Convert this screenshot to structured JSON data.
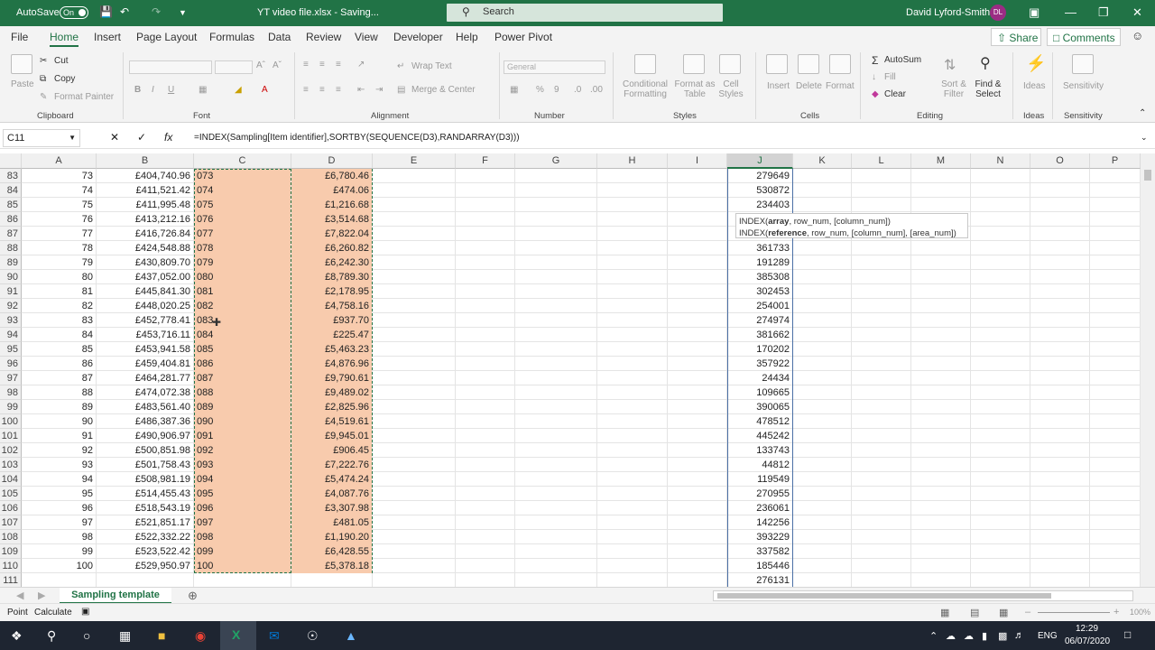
{
  "titlebar": {
    "autosave_label": "AutoSave",
    "autosave_state": "On",
    "document_title": "YT video file.xlsx  -  Saving...",
    "search_placeholder": "Search",
    "user_name": "David Lyford-Smith",
    "user_initials": "DL",
    "icons": [
      "save-icon",
      "undo-icon",
      "redo-icon",
      "customize-quick-access-icon",
      "ribbon-display-icon",
      "minimize-icon",
      "maximize-icon",
      "close-icon"
    ]
  },
  "menu": {
    "tabs": [
      "File",
      "Home",
      "Insert",
      "Page Layout",
      "Formulas",
      "Data",
      "Review",
      "View",
      "Developer",
      "Help",
      "Power Pivot"
    ],
    "active_tab": "Home",
    "share_label": "Share",
    "comments_label": "Comments"
  },
  "ribbon": {
    "clipboard": {
      "label": "Clipboard",
      "paste": "Paste",
      "cut": "Cut",
      "copy": "Copy",
      "format_painter": "Format Painter"
    },
    "font": {
      "label": "Font",
      "bold": "B",
      "italic": "I",
      "underline": "U"
    },
    "alignment": {
      "label": "Alignment",
      "wrap_text": "Wrap Text",
      "merge_center": "Merge & Center"
    },
    "number": {
      "label": "Number",
      "format": "General"
    },
    "styles": {
      "label": "Styles",
      "conditional_formatting": "Conditional Formatting",
      "format_as_table": "Format as Table",
      "cell_styles": "Cell Styles"
    },
    "cells": {
      "label": "Cells",
      "insert": "Insert",
      "delete": "Delete",
      "format": "Format"
    },
    "editing": {
      "label": "Editing",
      "autosum": "AutoSum",
      "fill": "Fill",
      "clear": "Clear",
      "sort_filter": "Sort & Filter",
      "find_select": "Find & Select"
    },
    "ideas": {
      "label": "Ideas",
      "ideas": "Ideas"
    },
    "sensitivity": {
      "label": "Sensitivity",
      "sensitivity": "Sensitivity"
    }
  },
  "formula_bar": {
    "name_box": "C11",
    "fx": "fx",
    "formula": "=INDEX(Sampling[Item identifier],SORTBY(SEQUENCE(D3),RANDARRAY(D3)))"
  },
  "grid": {
    "columns": [
      "A",
      "B",
      "C",
      "D",
      "E",
      "F",
      "G",
      "H",
      "I",
      "J",
      "K",
      "L",
      "M",
      "N",
      "O",
      "P"
    ],
    "selected_column": "J",
    "rows": [
      {
        "n": "83",
        "a": "73",
        "b": "£404,740.96",
        "c": "073",
        "d": "£6,780.46",
        "j": "279649"
      },
      {
        "n": "84",
        "a": "74",
        "b": "£411,521.42",
        "c": "074",
        "d": "£474.06",
        "j": "530872"
      },
      {
        "n": "85",
        "a": "75",
        "b": "£411,995.48",
        "c": "075",
        "d": "£1,216.68",
        "j": "234403"
      },
      {
        "n": "86",
        "a": "76",
        "b": "£413,212.16",
        "c": "076",
        "d": "£3,514.68",
        "j": ""
      },
      {
        "n": "87",
        "a": "77",
        "b": "£416,726.84",
        "c": "077",
        "d": "£7,822.04",
        "j": ""
      },
      {
        "n": "88",
        "a": "78",
        "b": "£424,548.88",
        "c": "078",
        "d": "£6,260.82",
        "j": "361733"
      },
      {
        "n": "89",
        "a": "79",
        "b": "£430,809.70",
        "c": "079",
        "d": "£6,242.30",
        "j": "191289"
      },
      {
        "n": "90",
        "a": "80",
        "b": "£437,052.00",
        "c": "080",
        "d": "£8,789.30",
        "j": "385308"
      },
      {
        "n": "91",
        "a": "81",
        "b": "£445,841.30",
        "c": "081",
        "d": "£2,178.95",
        "j": "302453"
      },
      {
        "n": "92",
        "a": "82",
        "b": "£448,020.25",
        "c": "082",
        "d": "£4,758.16",
        "j": "254001"
      },
      {
        "n": "93",
        "a": "83",
        "b": "£452,778.41",
        "c": "083",
        "d": "£937.70",
        "j": "274974"
      },
      {
        "n": "94",
        "a": "84",
        "b": "£453,716.11",
        "c": "084",
        "d": "£225.47",
        "j": "381662"
      },
      {
        "n": "95",
        "a": "85",
        "b": "£453,941.58",
        "c": "085",
        "d": "£5,463.23",
        "j": "170202"
      },
      {
        "n": "96",
        "a": "86",
        "b": "£459,404.81",
        "c": "086",
        "d": "£4,876.96",
        "j": "357922"
      },
      {
        "n": "97",
        "a": "87",
        "b": "£464,281.77",
        "c": "087",
        "d": "£9,790.61",
        "j": "24434"
      },
      {
        "n": "98",
        "a": "88",
        "b": "£474,072.38",
        "c": "088",
        "d": "£9,489.02",
        "j": "109665"
      },
      {
        "n": "99",
        "a": "89",
        "b": "£483,561.40",
        "c": "089",
        "d": "£2,825.96",
        "j": "390065"
      },
      {
        "n": "100",
        "a": "90",
        "b": "£486,387.36",
        "c": "090",
        "d": "£4,519.61",
        "j": "478512"
      },
      {
        "n": "101",
        "a": "91",
        "b": "£490,906.97",
        "c": "091",
        "d": "£9,945.01",
        "j": "445242"
      },
      {
        "n": "102",
        "a": "92",
        "b": "£500,851.98",
        "c": "092",
        "d": "£906.45",
        "j": "133743"
      },
      {
        "n": "103",
        "a": "93",
        "b": "£501,758.43",
        "c": "093",
        "d": "£7,222.76",
        "j": "44812"
      },
      {
        "n": "104",
        "a": "94",
        "b": "£508,981.19",
        "c": "094",
        "d": "£5,474.24",
        "j": "119549"
      },
      {
        "n": "105",
        "a": "95",
        "b": "£514,455.43",
        "c": "095",
        "d": "£4,087.76",
        "j": "270955"
      },
      {
        "n": "106",
        "a": "96",
        "b": "£518,543.19",
        "c": "096",
        "d": "£3,307.98",
        "j": "236061"
      },
      {
        "n": "107",
        "a": "97",
        "b": "£521,851.17",
        "c": "097",
        "d": "£481.05",
        "j": "142256"
      },
      {
        "n": "108",
        "a": "98",
        "b": "£522,332.22",
        "c": "098",
        "d": "£1,190.20",
        "j": "393229"
      },
      {
        "n": "109",
        "a": "99",
        "b": "£523,522.42",
        "c": "099",
        "d": "£6,428.55",
        "j": "337582"
      },
      {
        "n": "110",
        "a": "100",
        "b": "£529,950.97",
        "c": "100",
        "d": "£5,378.18",
        "j": "185446"
      },
      {
        "n": "111",
        "a": "",
        "b": "",
        "c": "",
        "d": "",
        "j": "276131"
      }
    ],
    "tooltip": {
      "line1_func": "INDEX(",
      "line1_bold": "array",
      "line1_rest": ", row_num, [column_num])",
      "line2_func": "INDEX(",
      "line2_bold": "reference",
      "line2_rest": ", row_num, [column_num], [area_num])"
    }
  },
  "sheets": {
    "active": "Sampling template",
    "add_icon": "plus-icon"
  },
  "status": {
    "mode": "Point",
    "calc": "Calculate",
    "zoom": "100%"
  },
  "taskbar": {
    "lang": "ENG",
    "time": "12:29",
    "date": "06/07/2020"
  },
  "colors": {
    "excel_green": "#217346",
    "selection_fill": "#f8cbad",
    "taskbar": "#1e2531"
  }
}
